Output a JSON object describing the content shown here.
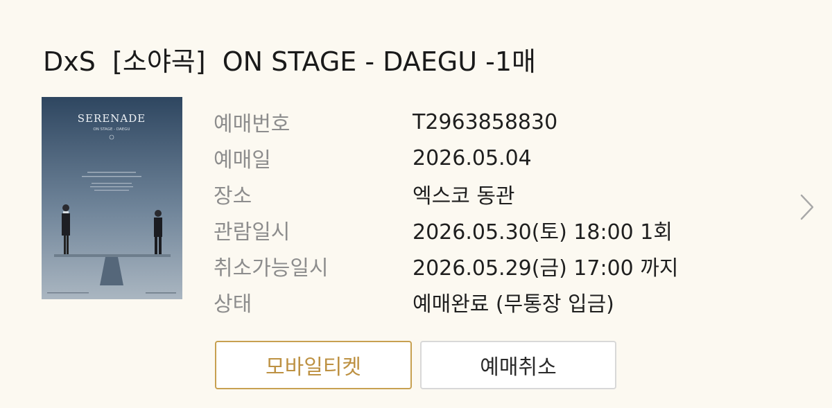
{
  "booking": {
    "title": "DxS  [소야곡]  ON STAGE - DAEGU -1매",
    "poster": {
      "heading": "SERENADE",
      "subtitle": "ON STAGE - DAEGU",
      "colors": {
        "sky_top": "#2e4660",
        "sky_bottom": "#a9b6c2"
      }
    },
    "details": [
      {
        "label": "예매번호",
        "value": "T2963858830"
      },
      {
        "label": "예매일",
        "value": "2026.05.04"
      },
      {
        "label": "장소",
        "value": "엑스코 동관"
      },
      {
        "label": "관람일시",
        "value": "2026.05.30(토) 18:00 1회"
      },
      {
        "label": "취소가능일시",
        "value": "2026.05.29(금) 17:00 까지"
      },
      {
        "label": "상태",
        "value": "예매완료 (무통장 입금)"
      }
    ],
    "buttons": {
      "mobile_ticket": "모바일티켓",
      "cancel_booking": "예매취소"
    },
    "icons": {
      "detail_arrow": "chevron-right-icon"
    },
    "colors": {
      "background": "#fcf9f1",
      "accent": "#c7a050",
      "label": "#8d8d8d"
    }
  }
}
